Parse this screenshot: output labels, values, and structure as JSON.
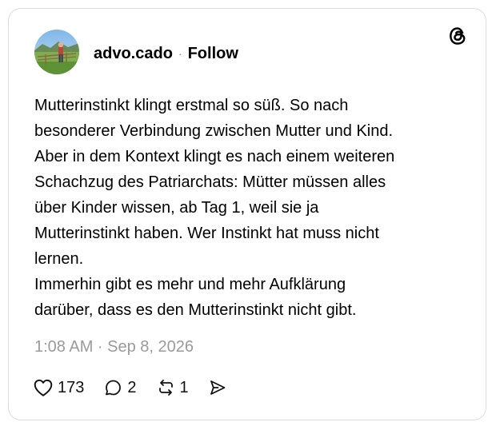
{
  "post": {
    "username": "advo.cado",
    "separator": "·",
    "follow_label": "Follow",
    "body": "Mutterinstinkt klingt erstmal so süß. So nach\nbesonderer Verbindung zwischen Mutter und Kind.\nAber in dem Kontext klingt es nach einem weiteren\nSchachzug des Patriarchats: Mütter müssen alles\nüber Kinder wissen, ab Tag 1, weil sie ja\nMutterinstinkt haben. Wer Instinkt hat muss nicht\nlernen.\nImmerhin gibt es mehr und mehr Aufklärung\ndarüber, dass es den Mutterinstinkt nicht gibt.",
    "timestamp": "1:08 AM · Sep 8, 2026"
  },
  "actions": {
    "likes": "173",
    "replies": "2",
    "reposts": "1"
  },
  "icons": {
    "like": "heart-icon",
    "reply": "comment-bubble-icon",
    "repost": "repost-arrows-icon",
    "share": "send-icon",
    "brand": "threads-logo-icon"
  },
  "colors": {
    "text": "#000000",
    "muted": "#9a9a9a",
    "border": "#dcdcdc"
  }
}
